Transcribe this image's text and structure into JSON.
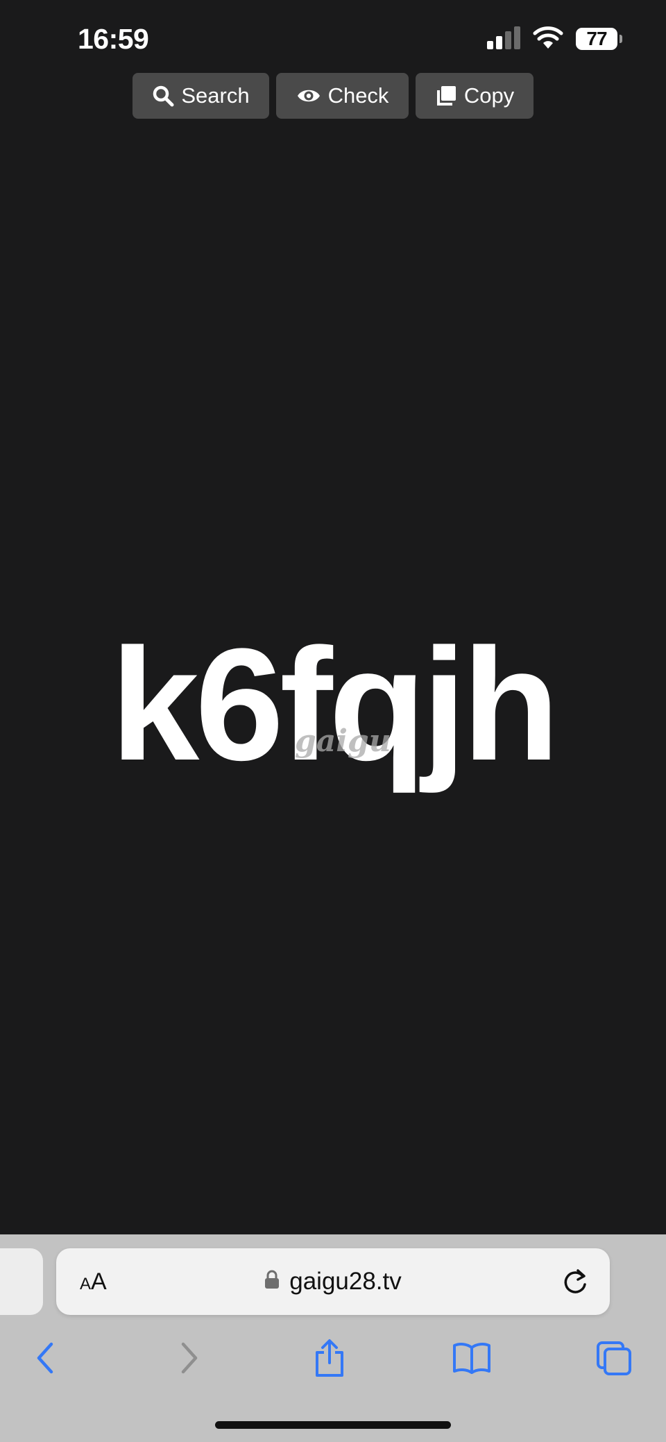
{
  "status_bar": {
    "time": "16:59",
    "battery": "77",
    "icons": [
      "signal-icon",
      "wifi-icon",
      "battery-icon"
    ]
  },
  "actions": {
    "search_label": "Search",
    "check_label": "Check",
    "copy_label": "Copy"
  },
  "content": {
    "code": "k6fqjh",
    "watermark": "gaigu"
  },
  "browser": {
    "text_size_label_small": "A",
    "text_size_label_large": "A",
    "url": "gaigu28.tv"
  },
  "colors": {
    "background": "#1a1a1b",
    "button_bg": "#4a4a4a",
    "toolbar_bg": "#c2c2c2",
    "link_blue": "#3478f6"
  }
}
